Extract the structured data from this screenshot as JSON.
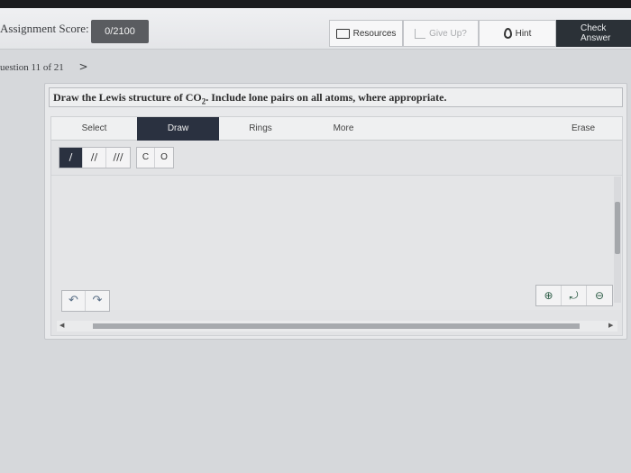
{
  "header": {
    "score_label": "Assignment Score:",
    "score_value": "0/2100",
    "resources": "Resources",
    "give_up": "Give Up?",
    "hint": "Hint",
    "check_answer": "Check Answer"
  },
  "nav": {
    "question_text": "uestion 11 of 21",
    "next_glyph": ">"
  },
  "question": {
    "prompt_before": "Draw the Lewis structure of CO",
    "prompt_sub": "2",
    "prompt_after": ". Include lone pairs on all atoms, where appropriate."
  },
  "editor": {
    "tabs": [
      "Select",
      "Draw",
      "Rings",
      "More"
    ],
    "erase": "Erase",
    "bond_tools": [
      "/",
      "//",
      "///"
    ],
    "atoms": [
      "C",
      "O"
    ],
    "undo": "↶",
    "redo": "↷",
    "zoom_in": "⊕",
    "zoom_reset": "⤾",
    "zoom_out": "⊖"
  },
  "colors": {
    "active_tab": "#2a3140",
    "check_button": "#2b3137",
    "score_box": "#5a5c60"
  }
}
